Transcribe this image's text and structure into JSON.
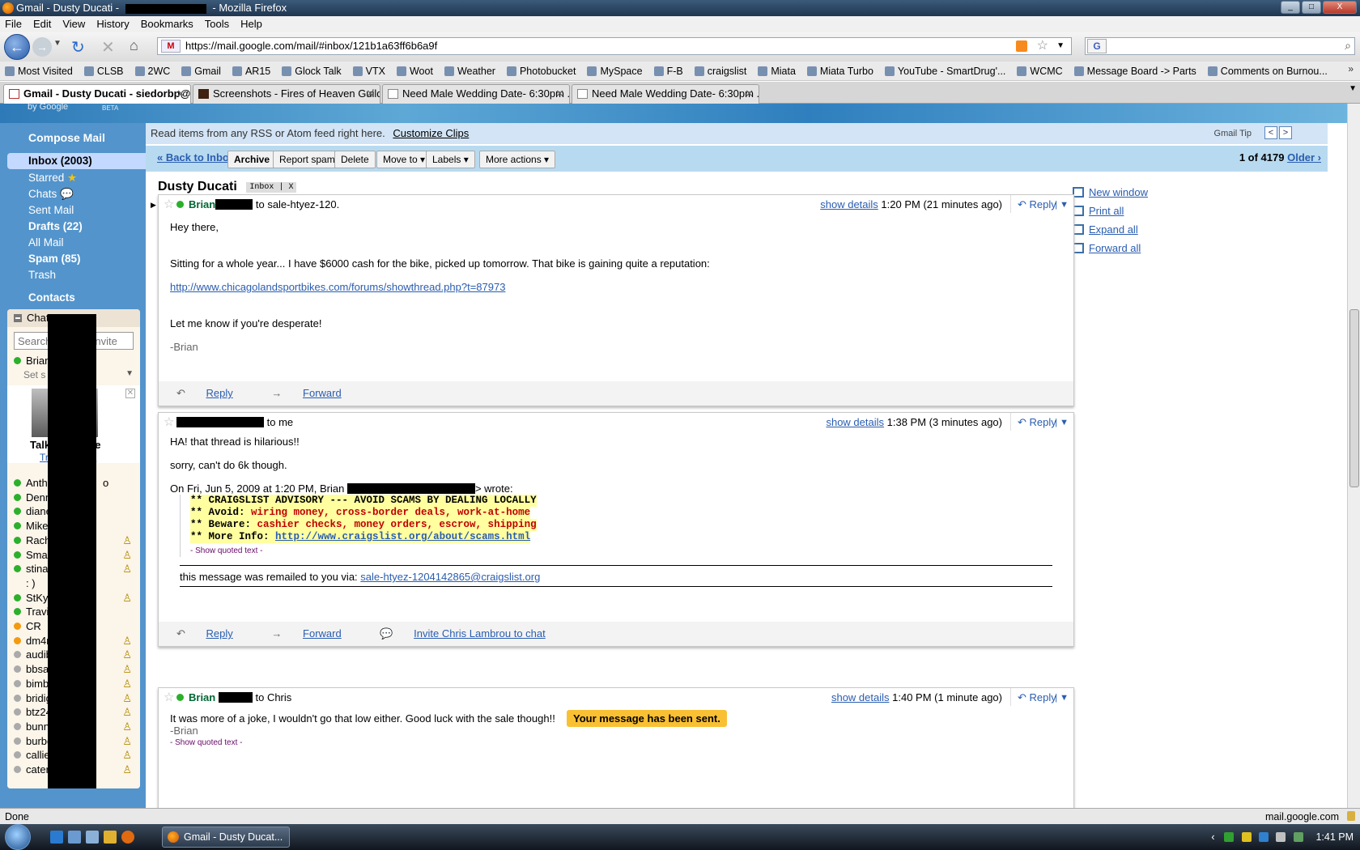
{
  "window": {
    "title_prefix": "Gmail - Dusty Ducati -",
    "title_suffix": "- Mozilla Firefox",
    "controls": [
      "_",
      "□",
      "X"
    ]
  },
  "menubar": [
    "File",
    "Edit",
    "View",
    "History",
    "Bookmarks",
    "Tools",
    "Help"
  ],
  "navbar": {
    "url": "https://mail.google.com/mail/#inbox/121b1a63ff6b6a9f",
    "search_engine_icon": "google-icon"
  },
  "bookmarks": [
    "Most Visited",
    "CLSB",
    "2WC",
    "Gmail",
    "AR15",
    "Glock Talk",
    "VTX",
    "Woot",
    "Weather",
    "Photobucket",
    "MySpace",
    "F-B",
    "craigslist",
    "Miata",
    "Miata Turbo",
    "YouTube - SmartDrug'...",
    "WCMC",
    "Message Board -> Parts",
    "Comments on Burnou..."
  ],
  "tabs": [
    {
      "label": "Gmail - Dusty Ducati - siedorbp@...",
      "active": true
    },
    {
      "label": "Screenshots - Fires of Heaven Guild ...",
      "active": false
    },
    {
      "label": "Need Male Wedding Date- 6:30pm ...",
      "active": false
    },
    {
      "label": "Need Male Wedding Date- 6:30pm ...",
      "active": false
    }
  ],
  "gmail": {
    "logo_text": "by Google",
    "beta_text": "BETA",
    "compose": "Compose Mail",
    "nav": {
      "inbox": "Inbox (2003)",
      "starred": "Starred",
      "chats": "Chats",
      "sent": "Sent Mail",
      "drafts": "Drafts (22)",
      "all": "All Mail",
      "spam": "Spam (85)",
      "trash": "Trash",
      "contacts": "Contacts"
    },
    "chat": {
      "header": "Chat",
      "search_placeholder": "Search, add, or invite",
      "me_name": "Brian",
      "status": "Set s",
      "talk_label_left": "Talk",
      "talk_label_right": "ce",
      "talk_link_left": "Tr",
      "talk_link_right": "t",
      "contacts": [
        {
          "name": "Antho",
          "extra": "o",
          "status": "green",
          "icon": false
        },
        {
          "name": "Denn",
          "extra": "",
          "status": "green",
          "icon": false
        },
        {
          "name": "diane",
          "extra": "",
          "status": "green",
          "icon": false
        },
        {
          "name": "Mike",
          "extra": "",
          "status": "green",
          "icon": false
        },
        {
          "name": "Rach",
          "extra": "",
          "status": "green",
          "icon": true
        },
        {
          "name": "Smar",
          "extra": "",
          "status": "green",
          "icon": true
        },
        {
          "name": "stina",
          "extra": "",
          "status": "green",
          "icon": true
        },
        {
          "name": ": )",
          "extra": "",
          "status": "none",
          "icon": false
        },
        {
          "name": "StKy",
          "extra": "",
          "status": "green",
          "icon": true
        },
        {
          "name": "Travis",
          "extra": "",
          "status": "green",
          "icon": false
        },
        {
          "name": "CR",
          "extra": "",
          "status": "orange",
          "icon": false
        },
        {
          "name": "dm4r",
          "extra": "",
          "status": "orange",
          "icon": true
        },
        {
          "name": "audib",
          "extra": "",
          "status": "gray",
          "icon": true
        },
        {
          "name": "bbsa",
          "extra": "",
          "status": "gray",
          "icon": true
        },
        {
          "name": "bimb",
          "extra": "",
          "status": "gray",
          "icon": true
        },
        {
          "name": "bridig",
          "extra": "",
          "status": "gray",
          "icon": true
        },
        {
          "name": "btz24",
          "extra": "",
          "status": "gray",
          "icon": true
        },
        {
          "name": "bunni",
          "extra": "",
          "status": "gray",
          "icon": true
        },
        {
          "name": "burbe",
          "extra": "",
          "status": "gray",
          "icon": true
        },
        {
          "name": "callie",
          "extra": "",
          "status": "gray",
          "icon": true
        },
        {
          "name": "cater",
          "extra": "",
          "status": "gray",
          "icon": true
        }
      ]
    },
    "clips": {
      "text": "Read items from any RSS or Atom feed right here.",
      "link": "Customize Clips",
      "tip": "Gmail Tip"
    },
    "toolbar": {
      "back": "« Back to Inbox",
      "archive": "Archive",
      "spam": "Report spam",
      "delete": "Delete",
      "move": "Move to ▾",
      "labels": "Labels ▾",
      "more": "More actions ▾",
      "pager_count": "1 of 4179",
      "pager_older": "Older ›"
    },
    "thread": {
      "subject": "Dusty Ducati",
      "label": "Inbox",
      "label_x": "X"
    },
    "right_links": [
      "New window",
      "Print all",
      "Expand all",
      "Forward all"
    ],
    "messages": [
      {
        "sender": "Brian",
        "to": "to sale-htyez-120.",
        "show_details": "show details",
        "time": "1:20 PM (21 minutes ago)",
        "reply": "Reply",
        "lines": [
          "Hey there,",
          "Sitting for a whole year... I have $6000 cash for the bike, picked up tomorrow.  That bike is gaining quite a reputation:"
        ],
        "link": "http://www.chicagolandsportbikes.com/forums/showthread.php?t=87973",
        "closing": "Let me know if you're desperate!",
        "sig": "-Brian",
        "foot_reply": "Reply",
        "foot_forward": "Forward"
      },
      {
        "to": "to me",
        "show_details": "show details",
        "time": "1:38 PM (3 minutes ago)",
        "reply": "Reply",
        "lines": [
          "HA!  that thread is hilarious!!",
          "sorry, can't do 6k though."
        ],
        "quote_intro_left": "On Fri, Jun 5, 2009 at 1:20 PM, Brian",
        "quote_intro_right": "> wrote:",
        "advisory": {
          "l1": "** CRAIGSLIST ADVISORY --- AVOID SCAMS BY DEALING LOCALLY",
          "l2a": "** Avoid: ",
          "l2b": "wiring money, cross-border deals, work-at-home",
          "l3a": "** Beware: ",
          "l3b": "cashier checks, money orders, escrow, shipping",
          "l4a": "** More Info: ",
          "l4b": "http://www.craigslist.org/about/scams.html"
        },
        "show_quoted": "- Show quoted text -",
        "remail_text": "this message was remailed to you via:",
        "remail_link": "sale-htyez-1204142865@craigslist.org",
        "foot_reply": "Reply",
        "foot_forward": "Forward",
        "foot_invite": "Invite Chris Lambrou to chat"
      },
      {
        "sender": "Brian",
        "to": "to Chris",
        "show_details": "show details",
        "time": "1:40 PM (1 minute ago)",
        "reply": "Reply",
        "line": "It was more of a joke, I wouldn't go that low either.  Good luck with the sale though!!",
        "sig": "-Brian",
        "show_quoted": "- Show quoted text -"
      }
    ],
    "sent_banner": "Your message has been sent."
  },
  "statusbar": {
    "left": "Done",
    "host": "mail.google.com"
  },
  "taskbar": {
    "task": "Gmail - Dusty Ducat...",
    "time": "1:41 PM"
  }
}
